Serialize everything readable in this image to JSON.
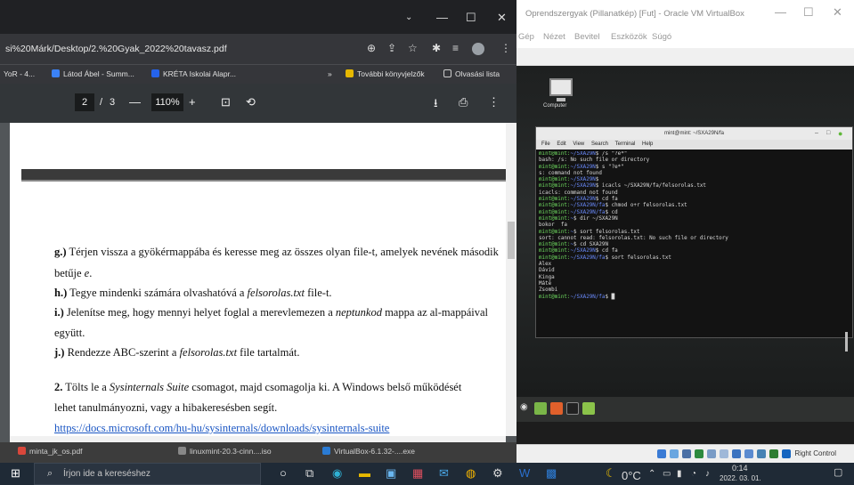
{
  "vbox": {
    "title": "Oprendszergyak (Pillanatkép) [Fut] - Oracle VM VirtualBox",
    "menu": [
      "Gép",
      "Nézet",
      "Bevitel",
      "Eszközök",
      "Súgó"
    ],
    "desktop_icon_label": "Computer",
    "status_right": "Right Control",
    "terminal": {
      "title": "mint@mint: ~/SXA29N/fa",
      "menu": [
        "File",
        "Edit",
        "View",
        "Search",
        "Terminal",
        "Help"
      ],
      "lines": [
        {
          "prompt": "mint@mint:",
          "dir": "~/SXA29N",
          "cmd": "$ /s \"?e*\""
        },
        {
          "text": "bash: /s: No such file or directory"
        },
        {
          "prompt": "mint@mint:",
          "dir": "~/SXA29N",
          "cmd": "$ s \"?e*\""
        },
        {
          "text": "s: command not found"
        },
        {
          "prompt": "mint@mint:",
          "dir": "~/SXA29N",
          "cmd": "$"
        },
        {
          "prompt": "mint@mint:",
          "dir": "~/SXA29N",
          "cmd": "$ icacls ~/SXA29N/fa/felsorolas.txt"
        },
        {
          "text": "icacls: command not found"
        },
        {
          "prompt": "mint@mint:",
          "dir": "~/SXA29N",
          "cmd": "$ cd fa"
        },
        {
          "prompt": "mint@mint:",
          "dir": "~/SXA29N/fa",
          "cmd": "$ chmod o+r felsorolas.txt"
        },
        {
          "prompt": "mint@mint:",
          "dir": "~/SXA29N/fa",
          "cmd": "$ cd"
        },
        {
          "prompt": "mint@mint:",
          "dir": "~",
          "cmd": "$ dir ~/SXA29N"
        },
        {
          "text": "bokor  fa"
        },
        {
          "prompt": "mint@mint:",
          "dir": "~",
          "cmd": "$ sort felsorolas.txt"
        },
        {
          "text": "sort: cannot read: felsorolas.txt: No such file or directory"
        },
        {
          "prompt": "mint@mint:",
          "dir": "~",
          "cmd": "$ cd SXA29N"
        },
        {
          "prompt": "mint@mint:",
          "dir": "~/SXA29N",
          "cmd": "$ cd fa"
        },
        {
          "prompt": "mint@mint:",
          "dir": "~/SXA29N/fa",
          "cmd": "$ sort felsorolas.txt"
        },
        {
          "text": "Alex"
        },
        {
          "text": "Dávid"
        },
        {
          "text": "Kinga"
        },
        {
          "text": "Máté"
        },
        {
          "text": "Zsombi"
        },
        {
          "prompt": "mint@mint:",
          "dir": "~/SXA29N/fa",
          "cmd": "$ █"
        }
      ]
    }
  },
  "chrome": {
    "url": "si%20Márk/Desktop/2.%20Gyak_2022%20tavasz.pdf",
    "bookmarks": [
      "YoR - 4...",
      "Látod Ábel - Summ...",
      "KRÉTA Iskolai Alapr...",
      "»",
      "További könyvjelzők",
      "Olvasási lista"
    ],
    "pdf": {
      "page_current": "2",
      "page_sep": "/",
      "page_total": "3",
      "zoom": "110%",
      "minus": "—",
      "plus": "+"
    },
    "doc": {
      "g_label": "g.)",
      "g_text1": " Térjen vissza a gyökérmappába és keresse meg az összes olyan file-t, amelyek nevének második",
      "g_text2a": "betűje ",
      "g_text2b": "e",
      "g_text2c": ".",
      "h_label": "h.)",
      "h_text1": " Tegye mindenki számára olvashatóvá a ",
      "h_file": "felsorolas.txt",
      "h_text2": " file-t.",
      "i_label": "i.)",
      "i_text1": " Jelenítse meg, hogy mennyi helyet foglal a merevlemezen a ",
      "i_dir": "neptunkod",
      "i_text2": " mappa az al-mappáival",
      "i_text3": "együtt.",
      "j_label": "j.)",
      "j_text1": " Rendezze ABC-szerint a ",
      "j_file": "felsorolas.txt",
      "j_text2": "  file tartalmát.",
      "p2_label": "2.",
      "p2_text1a": " Tölts le a ",
      "p2_suite": "Sysinternals Suite",
      "p2_text1b": " csomagot, majd csomagolja ki. A Windows belső működését",
      "p2_text2": "lehet tanulmányozni, vagy a hibakeresésben segít.",
      "link": "https://docs.microsoft.com/hu-hu/sysinternals/downloads/sysinternals-suite"
    },
    "downloads": [
      "minta_jk_os.pdf",
      "linuxmint-20.3-cinn....iso",
      "VirtualBox-6.1.32-....exe"
    ]
  },
  "taskbar": {
    "search_placeholder": "Írjon ide a kereséshez",
    "temp": "0°C",
    "time": "0:14",
    "date": "2022. 03. 01."
  },
  "colors": {
    "terminal_prompt": "#6fdc60",
    "terminal_dir": "#6b8cff",
    "link": "#1a56c4"
  }
}
